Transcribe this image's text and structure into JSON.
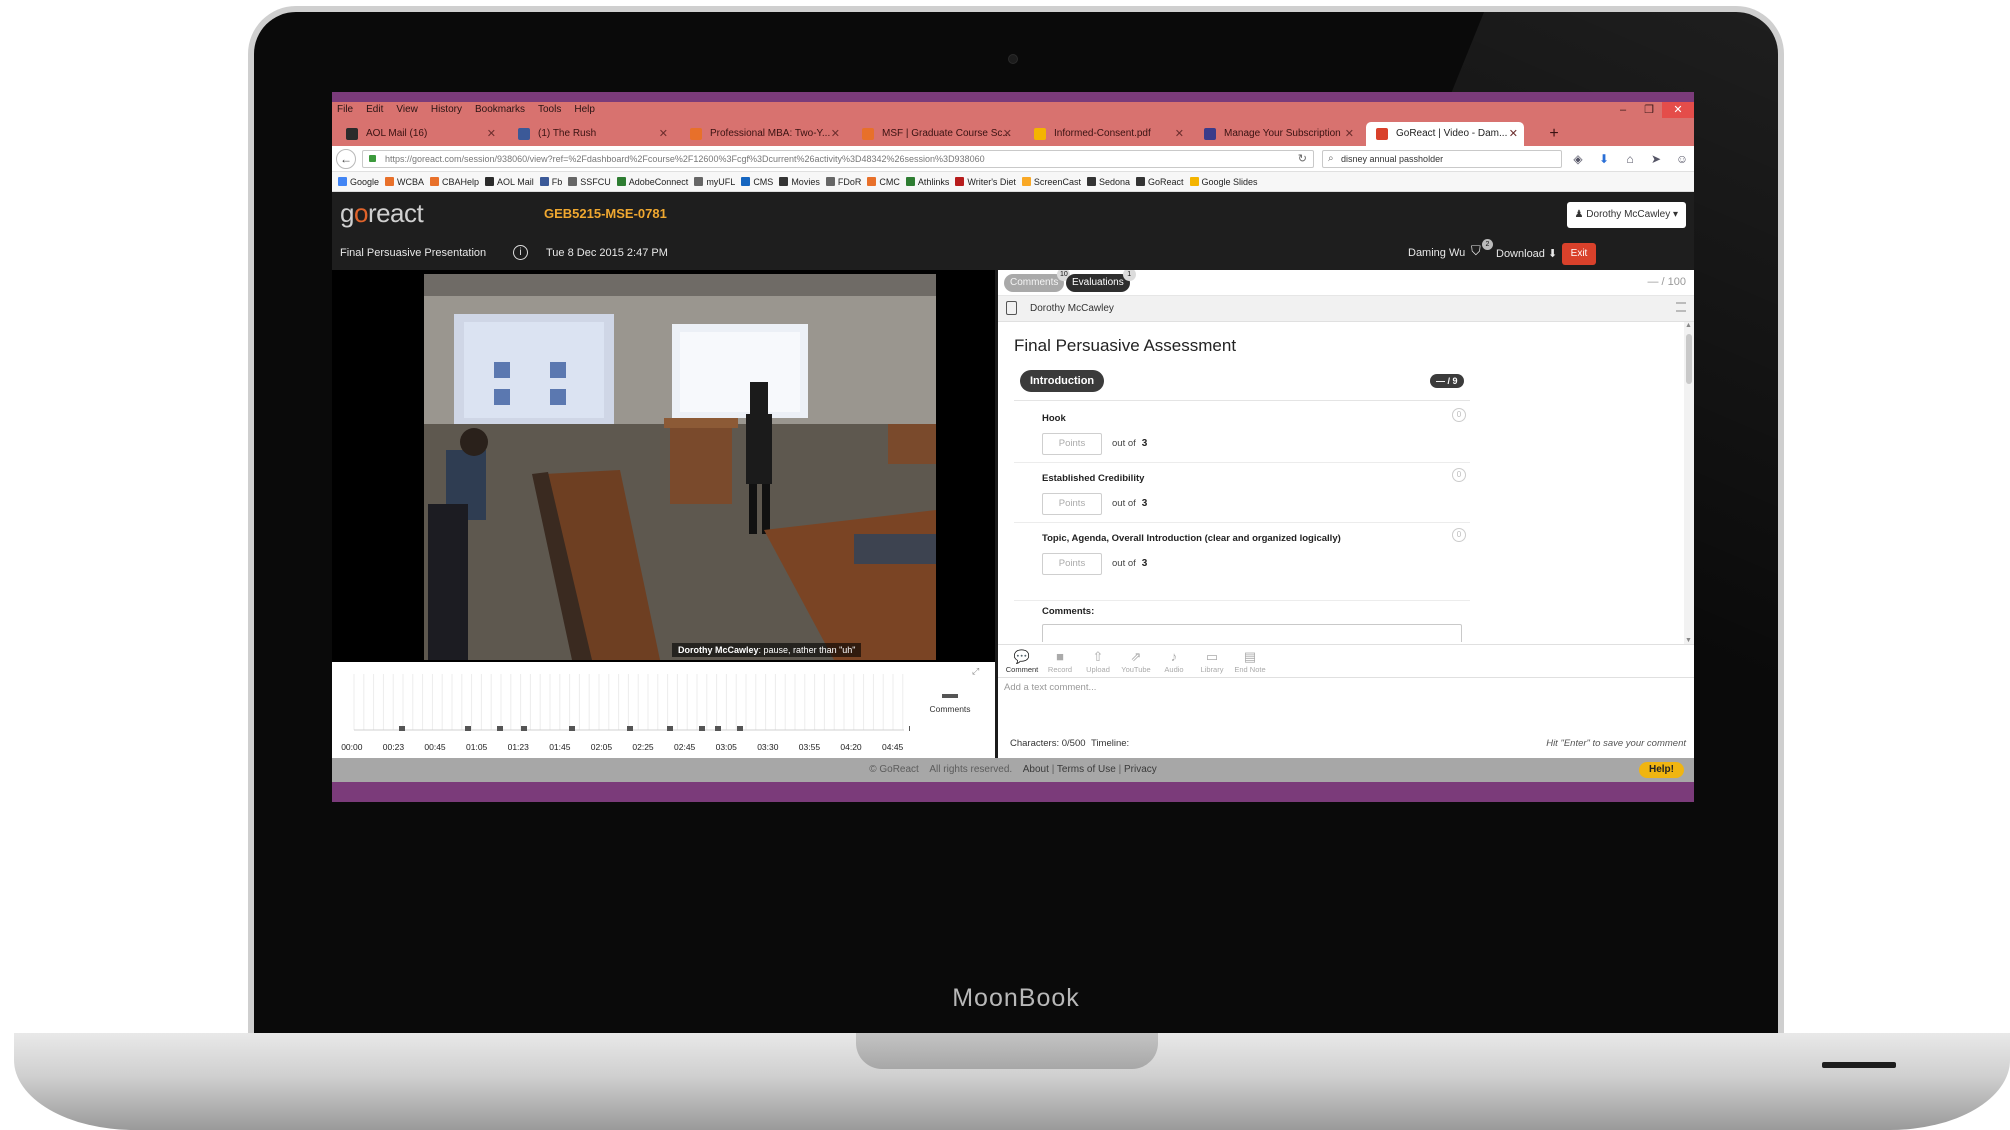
{
  "laptop": {
    "brand": "MoonBook"
  },
  "browser": {
    "menu": [
      "File",
      "Edit",
      "View",
      "History",
      "Bookmarks",
      "Tools",
      "Help"
    ],
    "window_controls": [
      "–",
      "❐",
      "✕"
    ],
    "tabs": [
      {
        "label": "AOL Mail (16)",
        "icon_color": "#2b2b2b"
      },
      {
        "label": "(1) The Rush",
        "icon_color": "#3b5998"
      },
      {
        "label": "Professional MBA: Two-Y...",
        "icon_color": "#e8702a"
      },
      {
        "label": "MSF | Graduate Course Sc...",
        "icon_color": "#e8702a"
      },
      {
        "label": "Informed-Consent.pdf",
        "icon_color": "#f4b400"
      },
      {
        "label": "Manage Your Subscription",
        "icon_color": "#3b3b8a"
      },
      {
        "label": "GoReact | Video - Dam...",
        "icon_color": "#d9412b"
      }
    ],
    "tab_close": "✕",
    "new_tab": "+",
    "url": "https://goreact.com/session/938060/view?ref=%2Fdashboard%2Fcourse%2F12600%3Fcgf%3Dcurrent%26activity%3D48342%26session%3D938060",
    "search": "disney annual passholder",
    "nav_icons": [
      "pocket-icon",
      "download-arrow-icon",
      "home-icon",
      "send-icon",
      "account-icon",
      "hamburger-menu-icon"
    ],
    "bookmarks": [
      {
        "label": "Google",
        "color": "#4285f4"
      },
      {
        "label": "WCBA",
        "color": "#e8702a"
      },
      {
        "label": "CBAHelp",
        "color": "#e8702a"
      },
      {
        "label": "AOL Mail",
        "color": "#2b2b2b"
      },
      {
        "label": "Fb",
        "color": "#3b5998"
      },
      {
        "label": "SSFCU",
        "color": "#666666"
      },
      {
        "label": "AdobeConnect",
        "color": "#2e7d32"
      },
      {
        "label": "myUFL",
        "color": "#666666"
      },
      {
        "label": "CMS",
        "color": "#1565c0"
      },
      {
        "label": "Movies",
        "color": "#333333"
      },
      {
        "label": "FDoR",
        "color": "#666666"
      },
      {
        "label": "CMC",
        "color": "#e8702a"
      },
      {
        "label": "Athlinks",
        "color": "#2e7d32"
      },
      {
        "label": "Writer's Diet",
        "color": "#b71c1c"
      },
      {
        "label": "ScreenCast",
        "color": "#f9a825"
      },
      {
        "label": "Sedona",
        "color": "#333333"
      },
      {
        "label": "GoReact",
        "color": "#333333"
      },
      {
        "label": "Google Slides",
        "color": "#f4b400"
      }
    ]
  },
  "app": {
    "logo_pre": "g",
    "logo_o": "o",
    "logo_post": "react",
    "course_code": "GEB5215-MSE-0781",
    "user_menu": "Dorothy McCawley ▾",
    "assignment_title": "Final Persuasive Presentation",
    "session_date": "Tue 8 Dec 2015  2:47 PM",
    "presenter": "Daming Wu",
    "presenter_badge": "2",
    "download_label": "Download",
    "exit_label": "Exit",
    "caption_name": "Dorothy McCawley",
    "caption_text": ": pause, rather than \"uh\"",
    "timeline": {
      "labels": [
        "00:00",
        "00:23",
        "00:45",
        "01:05",
        "01:23",
        "01:45",
        "02:05",
        "02:25",
        "02:45",
        "03:05",
        "03:30",
        "03:55",
        "04:20",
        "04:45"
      ],
      "legend": "Comments"
    },
    "panel": {
      "tab_comments": "Comments",
      "comments_count": "10",
      "tab_evaluations": "Evaluations",
      "evaluations_count": "1",
      "score_total": "— / 100",
      "evaluator": "Dorothy McCawley",
      "rubric_title": "Final Persuasive Assessment",
      "section": "Introduction",
      "section_score": "— / 9",
      "criteria": [
        {
          "name": "Hook",
          "placeholder": "Points",
          "out_of": "out of",
          "max": "3",
          "info": "0"
        },
        {
          "name": "Established Credibility",
          "placeholder": "Points",
          "out_of": "out of",
          "max": "3",
          "info": "0"
        },
        {
          "name": "Topic, Agenda, Overall Introduction (clear and organized logically)",
          "placeholder": "Points",
          "out_of": "out of",
          "max": "3",
          "info": "0"
        }
      ],
      "comments_label": "Comments:",
      "tools": [
        {
          "label": "Comment",
          "glyph": "💬"
        },
        {
          "label": "Record",
          "glyph": "■"
        },
        {
          "label": "Upload",
          "glyph": "⇧"
        },
        {
          "label": "YouTube",
          "glyph": "⇗"
        },
        {
          "label": "Audio",
          "glyph": "♪"
        },
        {
          "label": "Library",
          "glyph": "▭"
        },
        {
          "label": "End Note",
          "glyph": "▤"
        }
      ],
      "comment_placeholder": "Add a text comment...",
      "char_count": "Characters: 0/500",
      "timeline_label": "Timeline:",
      "enter_hint": "Hit \"Enter\" to save your comment"
    },
    "footer": {
      "copyright": "© GoReact",
      "rights": "All rights reserved.",
      "about": "About",
      "sep": "|",
      "terms": "Terms of Use",
      "privacy": "Privacy",
      "help": "Help!"
    }
  }
}
